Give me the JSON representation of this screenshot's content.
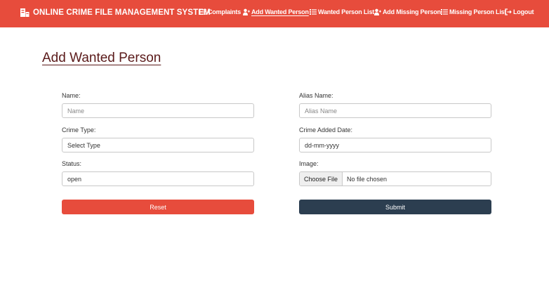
{
  "app": {
    "title": "ONLINE CRIME FILE MANAGEMENT SYSTEM"
  },
  "nav": {
    "items": [
      {
        "label": "Complaints",
        "icon": "list-icon"
      },
      {
        "label": "Add Wanted Person",
        "icon": "user-plus-icon"
      },
      {
        "label": "Wanted Person List",
        "icon": "list-icon"
      },
      {
        "label": "Add Missing Person",
        "icon": "user-plus-icon"
      },
      {
        "label": "Missing Person List",
        "icon": "list-icon"
      },
      {
        "label": "Logout",
        "icon": "sign-out-icon"
      }
    ],
    "active": "Add Wanted Person"
  },
  "page": {
    "title": "Add Wanted Person"
  },
  "form": {
    "name": {
      "label": "Name:",
      "placeholder": "Name"
    },
    "alias": {
      "label": "Alias Name:",
      "placeholder": "Alias Name"
    },
    "crime_type": {
      "label": "Crime Type:",
      "value": "Select Type"
    },
    "crime_date": {
      "label": "Crime Added Date:",
      "value": "dd-mm-yyyy"
    },
    "status": {
      "label": "Status:",
      "value": "open"
    },
    "image": {
      "label": "Image:",
      "button": "Choose File",
      "status": "No file chosen"
    },
    "reset_label": "Reset",
    "submit_label": "Submit"
  },
  "colors": {
    "navbar": "#e74c3c",
    "reset": "#e74c3c",
    "submit": "#2c3e50",
    "title": "#5a1a1a"
  }
}
